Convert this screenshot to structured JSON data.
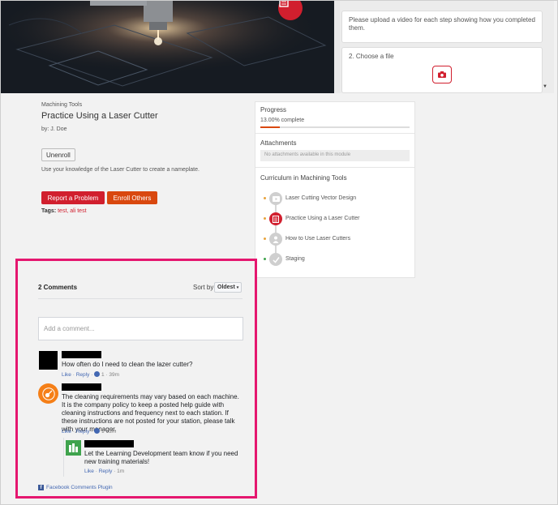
{
  "upload": {
    "card1_text": "Please upload a video for each step showing how you completed them.",
    "card2_text": "2. Choose a file"
  },
  "module": {
    "breadcrumb": "Machining Tools",
    "title": "Practice Using a Laser Cutter",
    "byline": "by: J. Doe",
    "unenroll_label": "Unenroll",
    "description": "Use your knowledge of the Laser Cutter to create a nameplate.",
    "report_label": "Report a Problem",
    "enroll_label": "Enroll Others",
    "tags_label": "Tags:",
    "tags_value": "test, ali test"
  },
  "sidebar": {
    "progress_title": "Progress",
    "progress_text": "13.00% complete",
    "progress_value": 0.13,
    "attachments_title": "Attachments",
    "attachments_empty": "No attachments available in this module",
    "curriculum_title": "Curriculum in Machining Tools",
    "items": [
      {
        "label": "Laser Cutting Vector Design",
        "icon": "video-icon",
        "status": "in-progress"
      },
      {
        "label": "Practice Using a Laser Cutter",
        "icon": "document-icon",
        "status": "current"
      },
      {
        "label": "How to Use Laser Cutters",
        "icon": "person-icon",
        "status": "in-progress"
      },
      {
        "label": "Staging",
        "icon": "check-icon",
        "status": "complete"
      }
    ]
  },
  "comments": {
    "count_label": "2 Comments",
    "sort_label": "Sort by",
    "sort_value": "Oldest",
    "placeholder": "Add a comment...",
    "list": [
      {
        "text": "How often do I need to clean the lazer cutter?",
        "like": "Like",
        "reply": "Reply",
        "likes": "1",
        "time": "39m"
      },
      {
        "text": "The cleaning requirements may vary based on each machine. It is the company policy to keep a posted help guide with cleaning instructions and frequency next to each station. If these instructions are not posted for your station, please talk with your manager.",
        "like": "Like",
        "reply": "Reply",
        "likes": "1",
        "time": "2m"
      },
      {
        "text": "Let the Learning Development team know if you need new training materials!",
        "like": "Like",
        "reply": "Reply",
        "time": "1m"
      }
    ],
    "plugin_label": "Facebook Comments Plugin"
  },
  "colors": {
    "brand_red": "#d11f2e",
    "enroll_orange": "#d9480f",
    "highlight_pink": "#e5176f",
    "facebook_blue": "#4267b2"
  }
}
